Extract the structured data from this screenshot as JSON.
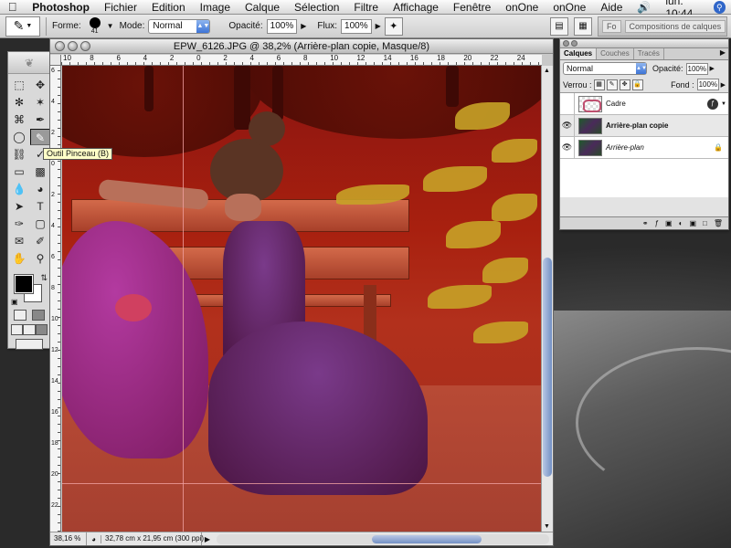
{
  "menubar": {
    "apple_icon": "apple-icon",
    "app_name": "Photoshop",
    "items": [
      "Fichier",
      "Edition",
      "Image",
      "Calque",
      "Sélection",
      "Filtre",
      "Affichage",
      "Fenêtre",
      "onOne",
      "onOne",
      "Aide"
    ],
    "volume_icon": "speaker-icon",
    "clock": "lun. 10:44",
    "spotlight_icon": "spotlight-icon"
  },
  "options": {
    "forme_label": "Forme:",
    "brush_size": "41",
    "mode_label": "Mode:",
    "mode_value": "Normal",
    "opacite_label": "Opacité:",
    "opacite_value": "100%",
    "flux_label": "Flux:",
    "flux_value": "100%",
    "compositions_tab": "Compositions de calques",
    "well_tab_short": "Fo"
  },
  "tooltip": "Outil Pinceau (B)",
  "document": {
    "title": "EPW_6126.JPG @ 38,2% (Arrière-plan copie, Masque/8)",
    "ruler_top": [
      "10",
      "8",
      "6",
      "4",
      "2",
      "0",
      "2",
      "4",
      "6",
      "8",
      "10",
      "12",
      "14",
      "16",
      "18",
      "20",
      "22",
      "24"
    ],
    "ruler_left": [
      "6",
      "4",
      "2",
      "0",
      "2",
      "4",
      "6",
      "8",
      "10",
      "12",
      "14",
      "16",
      "18",
      "20",
      "22"
    ],
    "zoom": "38,16 %",
    "doc_info": "32,78 cm x 21,95 cm (300 ppi)"
  },
  "layers_panel": {
    "tabs": [
      "Calques",
      "Couches",
      "Tracés"
    ],
    "blend_mode": "Normal",
    "opacite_label": "Opacité:",
    "opacite_value": "100%",
    "verrou_label": "Verrou :",
    "fond_label": "Fond :",
    "fond_value": "100%",
    "layers": [
      {
        "name": "Cadre",
        "visible": false
      },
      {
        "name": "Arrière-plan copie",
        "visible": true
      },
      {
        "name": "Arrière-plan",
        "visible": true
      }
    ]
  }
}
